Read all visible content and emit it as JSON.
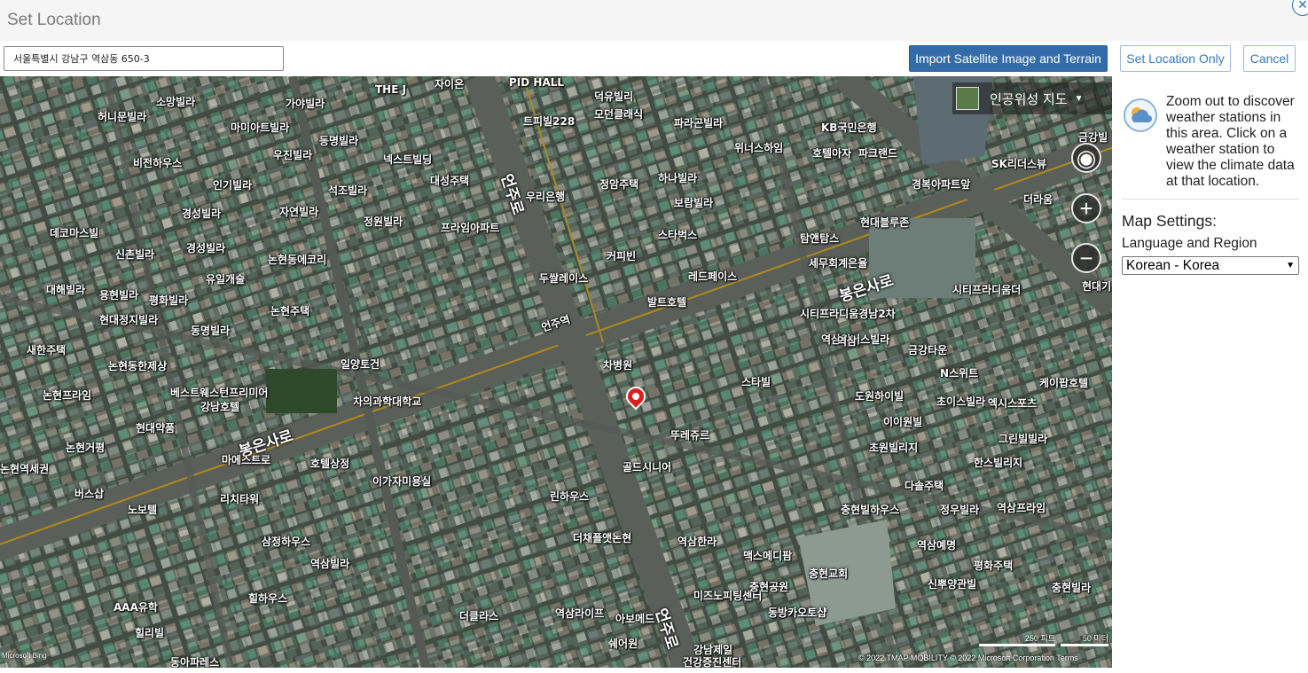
{
  "dialog": {
    "title": "Set Location",
    "close_icon": "close-icon",
    "address_value": "서울특별시 강남구 역삼동 650-3",
    "buttons": {
      "import": "Import Satellite Image and Terrain",
      "set_location": "Set Location Only",
      "cancel": "Cancel"
    }
  },
  "map": {
    "type_selector": "인공위성 지도",
    "roads": [
      "봉은사로",
      "봉은사로",
      "언주로",
      "언주로"
    ],
    "places": [
      "자이온",
      "PID HALL",
      "THE J",
      "가야빌라",
      "소망빌라",
      "허니문빌라",
      "마미아트빌라",
      "우진빌라",
      "비전하우스",
      "인기빌라",
      "동명빌라",
      "넥스트빌딩",
      "대성주택",
      "석조빌라",
      "자연빌라",
      "경성빌라",
      "정원빌라",
      "데코마스빌",
      "프라임아파트",
      "신촌빌라",
      "경성빌라",
      "논현동에코리",
      "유일개술",
      "대해빌라",
      "용현빌라",
      "평화빌라",
      "현대정지빌라",
      "논현주택",
      "동명빌라",
      "새한주택",
      "논현동한제상",
      "일양토건",
      "베스트웨스턴프리미어",
      "강남호텔",
      "논현프라임",
      "현대약품",
      "차의과학대학교",
      "논현거평",
      "마에스트로",
      "호텔상정",
      "이가자미용실",
      "논현역세권",
      "버스삽",
      "리치타워",
      "노보텔",
      "린하우스",
      "더채플앳논현",
      "삼정하우스",
      "역삼빌라",
      "힐하우스",
      "AAA유학",
      "힐리빌",
      "동아파레스",
      "더클라스",
      "역삼라이프",
      "아보메드",
      "쉐어원",
      "강남제일",
      "건강증진센터",
      "골드시니어",
      "뚜레쥬르",
      "스타빌",
      "도원하이빌",
      "이이원빌",
      "초원빌리지",
      "다솔주택",
      "정우빌라",
      "충현빌하우스",
      "역삼예명",
      "역삼한라",
      "맥스메디팜",
      "미즈노피팅센터",
      "충현공원",
      "충현교회",
      "동방카오토샵",
      "평화주택",
      "신뿌양관빌",
      "충현빌라",
      "우리은행",
      "정암주택",
      "하나빌라",
      "보람빌라",
      "스타벅스",
      "커피빈",
      "레드페이스",
      "발트호텔",
      "두쌀레이스",
      "차병원",
      "트피빌228",
      "덕유빌리",
      "모던클래식",
      "파라곤빌라",
      "위너스하임",
      "KB국민은행",
      "호텔아자",
      "파크랜드",
      "경복아파트앞",
      "현대블루존",
      "탐앤탐스",
      "세무회계은율",
      "시티프라디움더",
      "시티프라디움경남2차",
      "역삼위너스빌라",
      "금강타운",
      "N스위트",
      "초이스빌라",
      "엑시스포츠",
      "케이팝호텔",
      "그린빌빌라",
      "한스빌리지",
      "역삼프라임",
      "SK리더스뷰",
      "더라움",
      "금강빌",
      "언주역",
      "역삼",
      "현대기"
    ],
    "scale_labels": [
      "250 피트",
      "50 미터"
    ],
    "attribution": "© 2022 TMAP MOBILITY © 2022 Microsoft Corporation  Terms",
    "logo_text": "Microsoft Bing"
  },
  "sidebar": {
    "weather_icon": "weather-station-icon",
    "weather_text": "Zoom out to discover weather stations in this area. Click on a weather station to view the climate data at that location.",
    "settings_title": "Map Settings:",
    "language_label": "Language and Region",
    "language_value": "Korean - Korea"
  }
}
